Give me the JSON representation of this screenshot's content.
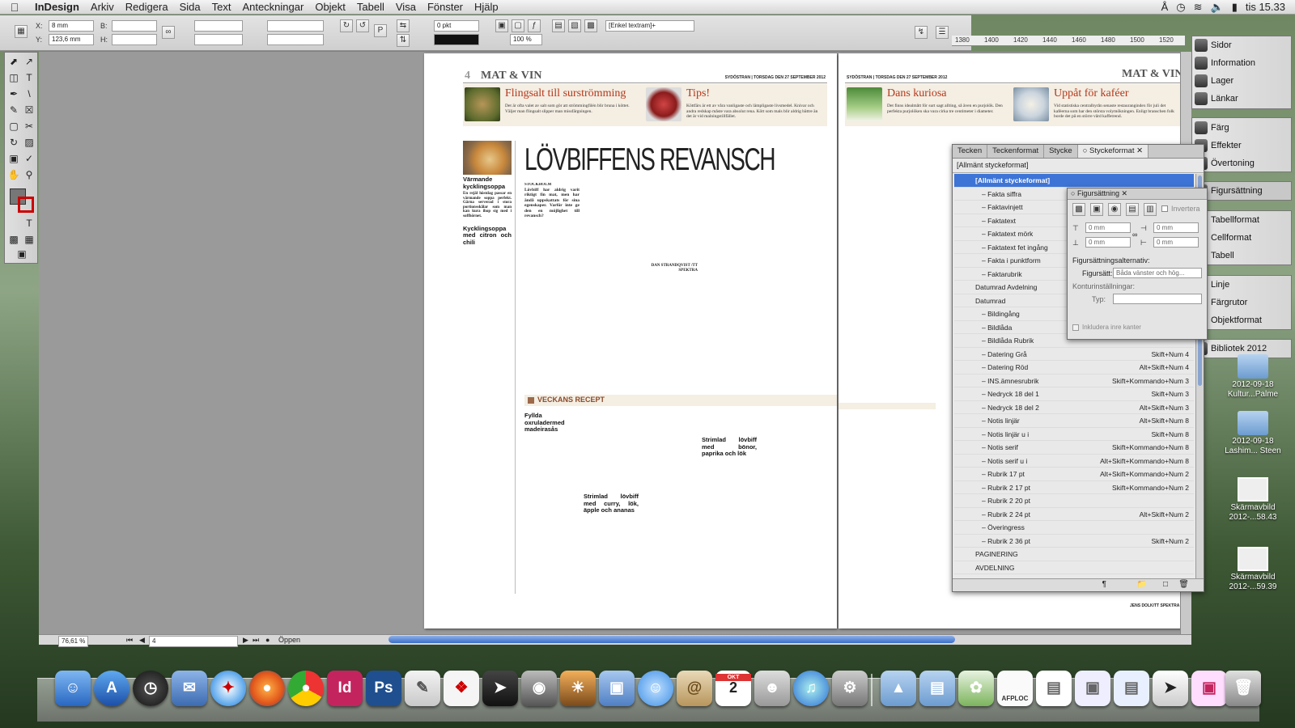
{
  "menubar": {
    "app": "InDesign",
    "items": [
      "Arkiv",
      "Redigera",
      "Sida",
      "Text",
      "Anteckningar",
      "Objekt",
      "Tabell",
      "Visa",
      "Fönster",
      "Hjälp"
    ],
    "clock": "tis 15.33"
  },
  "control": {
    "x_label": "X:",
    "x_value": "8 mm",
    "y_label": "Y:",
    "y_value": "123,6 mm",
    "w_label": "B:",
    "h_label": "H:",
    "stroke_value": "0 pkt",
    "opacity_value": "100 %",
    "frame_style": "[Enkel textram]+"
  },
  "ruler": [
    "1380",
    "1400",
    "1420",
    "1440",
    "1460",
    "1480",
    "1500",
    "1520"
  ],
  "page_left": {
    "page_no": "4",
    "section": "MAT & VIN",
    "dateline": "SYDÖSTRAN | TORSDAG DEN 27 SEPTEMBER 2012",
    "teaser1_title": "Flingsalt till surströmming",
    "teaser1_body": "Det är ofta valet av salt som gör att strömmingfilén blir bruna i köttet. Väljer man flingsalt slipper man missfärgningen.",
    "teaser2_title": "Tips!",
    "teaser2_body": "Köttfärs är ett av våra vanligaste och lämpligaste livsmedel. Knivar och andra redskap måste vara absolut rena. Kött som mals blir aldrig bättre än det är vid malningstillfället.",
    "headline": "LÖVBIFFENS REVANSCH",
    "side_title1": "Värmande kycklingsoppa",
    "side_lead": "En rejäl höstdag passar en värmande soppa perfekt. Gärna serverad i stora portionsskålar som man kan kura ihop sig med i soffhörnet.",
    "side_title2": "Kycklingsoppa med citron och chili",
    "article_kicker": "STOCKHOLM",
    "article_lead": "Lövbiff har aldrig varit riktigt fin mat, men har ändå uppskattats för sina egenskaper. Varför inte ge den en möjlighet till revansch?",
    "byline": "DAN STRANDQVIST /TT SPEKTRA",
    "recipe_bar": "VECKANS RECEPT",
    "recipe1": "Fyllda oxruladermed madeirasås",
    "recipe2": "Strimlad lövbiff med curry, lök, äpple och ananas",
    "recipe3": "Strimlad lövbiff med bönor, paprika och lök"
  },
  "page_right": {
    "dateline": "SYDÖSTRAN | TORSDAG DEN 27 SEPTEMBER 2012",
    "section": "MAT & VIN",
    "teaser1_title": "Dans kuriosa",
    "teaser1_body": "Det finns idealmått för surt sagt allting, så även en purjolök. Den perfekta purjolöken ska vara cirka tre centimeter i diameter.",
    "teaser2_title": "Uppåt för kaféer",
    "teaser2_body": "Vid statistiska centralbyrån senaste restaurangindex för juli det kaféerna som har den största volymökningen. Enligt branschen folk borde det på en större vård kaffetrend.",
    "footer_byline": "JENS DOLK/TT SPEKTRA"
  },
  "status": {
    "zoom": "76,61 %",
    "page": "4",
    "state": "Öppen"
  },
  "right_panels": [
    [
      "Sidor",
      "Information",
      "Lager",
      "Länkar"
    ],
    [
      "Färg",
      "Effekter",
      "Övertoning"
    ],
    [
      "Figursättning"
    ],
    [
      "Tabellformat",
      "Cellformat",
      "Tabell"
    ],
    [
      "Linje",
      "Färgrutor",
      "Objektformat"
    ],
    [
      "Bibliotek 2012"
    ]
  ],
  "styles_panel": {
    "tabs": [
      "Tecken",
      "Teckenformat",
      "Stycke",
      "Styckeformat"
    ],
    "current": "[Allmänt styckeformat]",
    "rows": [
      {
        "name": "[Allmänt styckeformat]",
        "sc": "",
        "indent": false,
        "sel": true
      },
      {
        "name": "Fakta siffra",
        "sc": "",
        "indent": true
      },
      {
        "name": "Faktavinjett",
        "sc": "",
        "indent": true
      },
      {
        "name": "Faktatext",
        "sc": "",
        "indent": true
      },
      {
        "name": "Faktatext mörk",
        "sc": "",
        "indent": true
      },
      {
        "name": "Faktatext fet ingång",
        "sc": "",
        "indent": true
      },
      {
        "name": "Fakta i punktform",
        "sc": "",
        "indent": true
      },
      {
        "name": "Faktarubrik",
        "sc": "",
        "indent": true
      },
      {
        "name": "Datumrad Avdelning",
        "sc": "",
        "indent": false
      },
      {
        "name": "Datumrad",
        "sc": "",
        "indent": false
      },
      {
        "name": "Bildingång",
        "sc": "",
        "indent": true
      },
      {
        "name": "Bildlåda",
        "sc": "",
        "indent": true
      },
      {
        "name": "Bildlåda Rubrik",
        "sc": "",
        "indent": true
      },
      {
        "name": "Datering Grå",
        "sc": "Skift+Num 4",
        "indent": true
      },
      {
        "name": "Datering Röd",
        "sc": "Alt+Skift+Num 4",
        "indent": true
      },
      {
        "name": "INS.ämnesrubrik",
        "sc": "Skift+Kommando+Num 3",
        "indent": true
      },
      {
        "name": "Nedryck 18 del 1",
        "sc": "Skift+Num 3",
        "indent": true
      },
      {
        "name": "Nedryck 18 del 2",
        "sc": "Alt+Skift+Num 3",
        "indent": true
      },
      {
        "name": "Notis linjär",
        "sc": "Alt+Skift+Num 8",
        "indent": true
      },
      {
        "name": "Notis linjär u i",
        "sc": "Skift+Num 8",
        "indent": true
      },
      {
        "name": "Notis serif",
        "sc": "Skift+Kommando+Num 8",
        "indent": true
      },
      {
        "name": "Notis serif u i",
        "sc": "Alt+Skift+Kommando+Num 8",
        "indent": true
      },
      {
        "name": "Rubrik 17 pt",
        "sc": "Alt+Skift+Kommando+Num 2",
        "indent": true
      },
      {
        "name": "Rubrik 2 17 pt",
        "sc": "Skift+Kommando+Num 2",
        "indent": true
      },
      {
        "name": "Rubrik 2 20 pt",
        "sc": "",
        "indent": true
      },
      {
        "name": "Rubrik 2 24 pt",
        "sc": "Alt+Skift+Num 2",
        "indent": true
      },
      {
        "name": "Överingress",
        "sc": "",
        "indent": true
      },
      {
        "name": "Rubrik 2 36 pt",
        "sc": "Skift+Num 2",
        "indent": true
      },
      {
        "name": "PAGINERING",
        "sc": "",
        "indent": false
      },
      {
        "name": "AVDELNING",
        "sc": "",
        "indent": false
      }
    ]
  },
  "fig_panel": {
    "title": "Figursättning",
    "invert": "Invertera",
    "offset_value": "0 mm",
    "options_label": "Figursättningsalternativ:",
    "wrap_label": "Figursätt:",
    "wrap_value": "Båda vänster och hög...",
    "contour_label": "Konturinställningar:",
    "type_label": "Typ:",
    "inner_edges": "Inkludera inre kanter"
  },
  "desktop": [
    {
      "label": "2012-09-18 Kultur...Palme"
    },
    {
      "label": "2012-09-18 Lashim... Steen"
    },
    {
      "label": "Skärmavbild 2012-...58.43"
    },
    {
      "label": "Skärmavbild 2012-...59.39"
    }
  ],
  "dock": {
    "indesign": "Id",
    "photoshop": "Ps",
    "calendar_month": "OKT",
    "calendar_day": "2",
    "pdf_label": "AFPLOC"
  },
  "colors": {
    "accent_red": "#b5371a",
    "selection": "#3d74d6",
    "teaser_bg": "#f4eee3"
  }
}
